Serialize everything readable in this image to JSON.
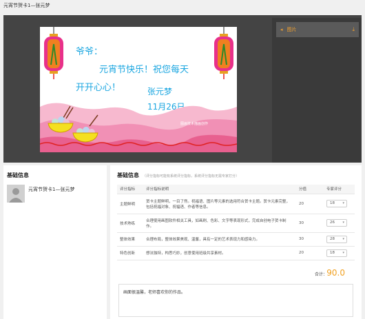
{
  "header": {
    "title": "元宵节贺卡1—张元梦"
  },
  "sidebar": {
    "item_label": "图片",
    "item_icon": "image-folder-icon",
    "download_icon": "download-icon"
  },
  "slide": {
    "greeting_line1": "爷爷：",
    "greeting_line2": "元宵节快乐！祝您每天",
    "greeting_line3": "开开心心！",
    "author": "张元梦",
    "date": "11月26日",
    "small_caption": "图画技术描画创作"
  },
  "basic_info": {
    "title": "基础信息",
    "name": "元宵节贺卡1—张元梦"
  },
  "evaluation": {
    "title": "基础信息",
    "note": "（评分指标可能有系统评分指标，系统评分指标无需专家打分）",
    "columns": [
      "评分指标",
      "评分指标说明",
      "分值",
      "专家评分"
    ],
    "rows": [
      {
        "name": "主题鲜明",
        "desc": "贺卡主题鲜明，一目了然。祝福语、图片等元素的选用符合贺卡主题。贺卡元素完整，包括祝福对象、祝福语、作者等信息。",
        "score": "20",
        "expert": "18"
      },
      {
        "name": "技术熟练",
        "desc": "合理使用画图软件相关工具，如画刷、色彩、文字等表现形式，完成自创电子贺卡制作。",
        "score": "30",
        "expert": "26"
      },
      {
        "name": "整体效果",
        "desc": "合理布局，整体效果美观、温馨，具有一定的艺术表现力和感染力。",
        "score": "30",
        "expert": "28"
      },
      {
        "name": "特色创新",
        "desc": "想法独特，构思巧妙，创意使用班级共享素材。",
        "score": "20",
        "expert": "18"
      }
    ],
    "total_label": "合计：",
    "total_value": "90.0",
    "comment": "画面很温馨，老师喜欢你的作品。"
  },
  "colors": {
    "accent": "#f0a020",
    "viewer_bg": "#444444",
    "slide_text": "#1aa6e0"
  }
}
